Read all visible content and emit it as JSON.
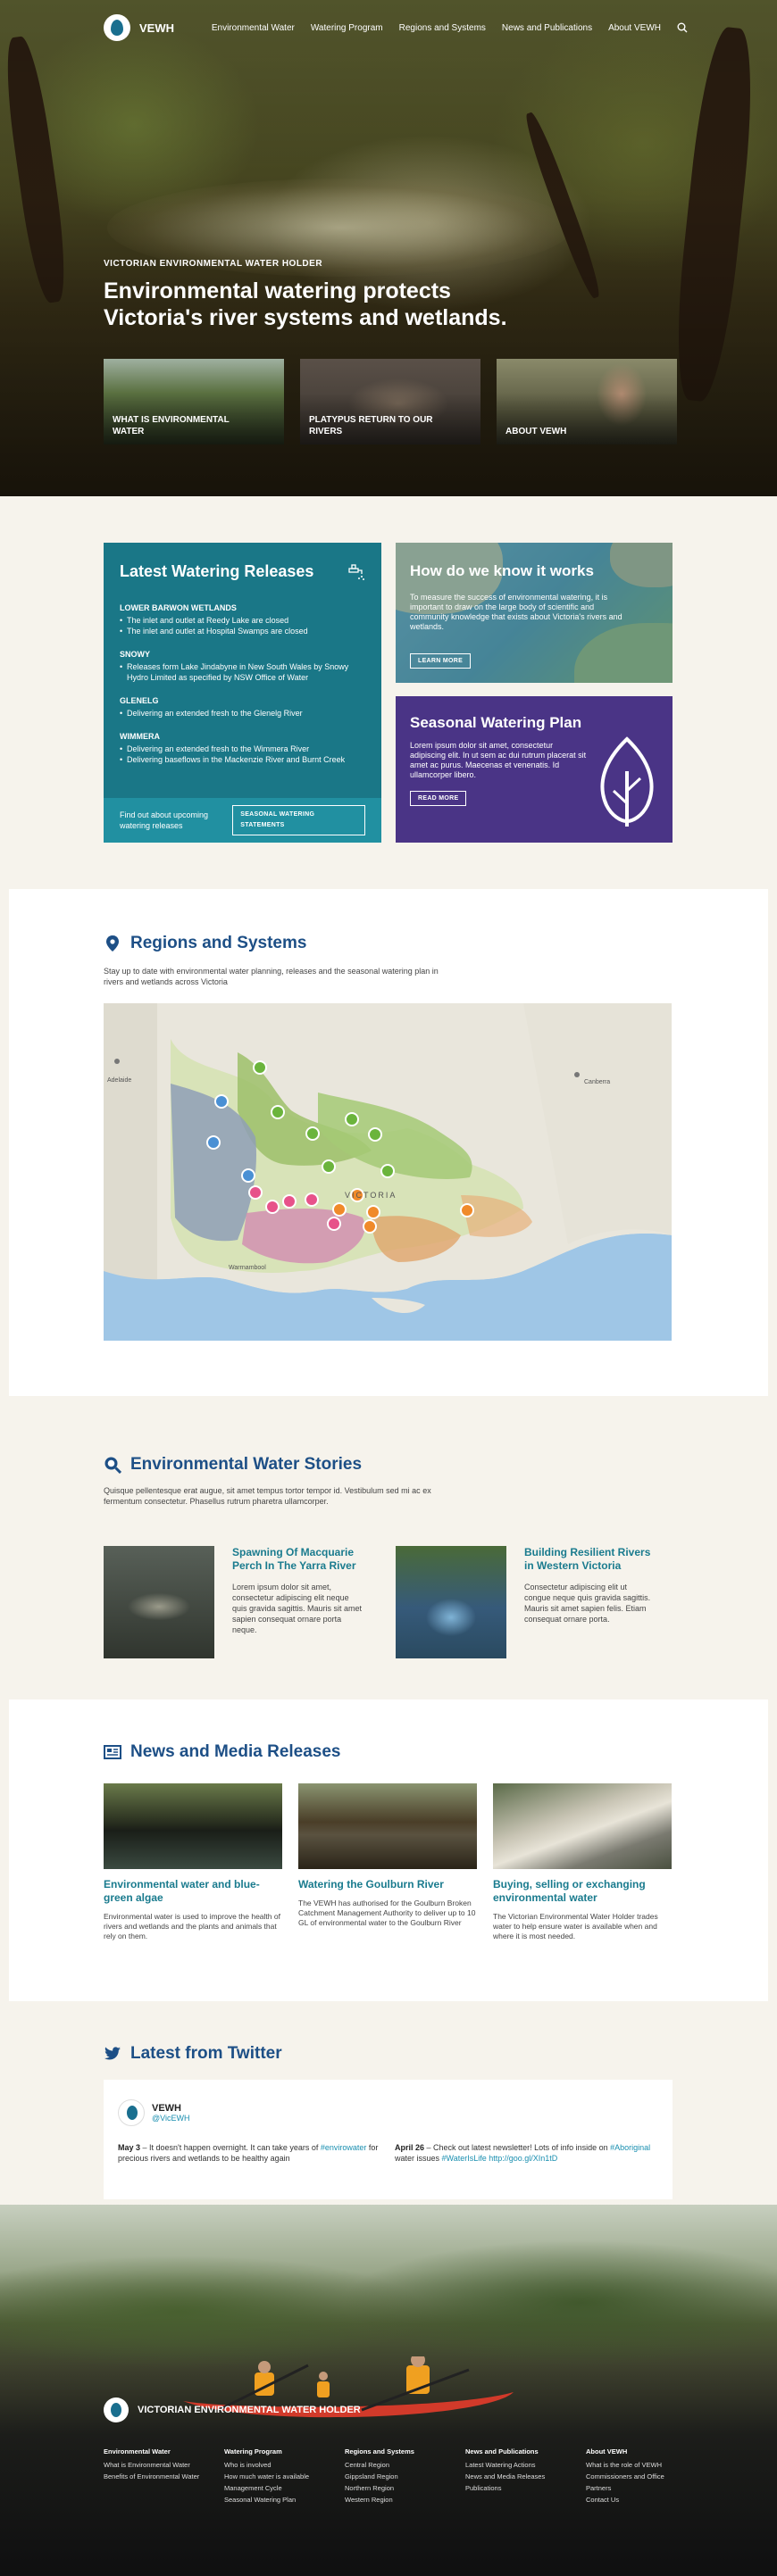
{
  "brand": {
    "name": "VEWH"
  },
  "nav": {
    "items": [
      "Environmental Water",
      "Watering Program",
      "Regions and Systems",
      "News and Publications",
      "About VEWH"
    ]
  },
  "hero": {
    "eyebrow": "VICTORIAN ENVIRONMENTAL WATER HOLDER",
    "title": "Environmental watering protects Victoria's river systems and wetlands.",
    "tiles": [
      "WHAT IS ENVIRONMENTAL WATER",
      "PLATYPUS RETURN TO OUR RIVERS",
      "ABOUT VEWH"
    ]
  },
  "latest_releases": {
    "title": "Latest Watering Releases",
    "regions": [
      {
        "name": "LOWER BARWON WETLANDS",
        "items": [
          "The inlet and outlet at Reedy Lake are closed",
          "The inlet and outlet at Hospital Swamps are closed"
        ]
      },
      {
        "name": "SNOWY",
        "items": [
          "Releases form Lake Jindabyne in New South Wales by Snowy Hydro Limited as specified by NSW Office of Water"
        ]
      },
      {
        "name": "GLENELG",
        "items": [
          "Delivering an extended fresh to the Glenelg River"
        ]
      },
      {
        "name": "WIMMERA",
        "items": [
          "Delivering an extended fresh to the Wimmera River",
          "Delivering baseflows in the Mackenzie River and Burnt Creek"
        ]
      }
    ],
    "footer_text": "Find out about upcoming watering releases",
    "footer_button": "SEASONAL WATERING STATEMENTS"
  },
  "how_we_know": {
    "title": "How do we know it works",
    "body": "To measure the success of environmental watering, it is important to draw on the large body of scientific and community knowledge that exists about Victoria's rivers and wetlands.",
    "button": "LEARN MORE"
  },
  "seasonal_plan": {
    "title": "Seasonal Watering Plan",
    "body": "Lorem ipsum dolor sit amet, consectetur adipiscing elit. In ut sem ac dui rutrum placerat sit amet ac purus. Maecenas et venenatis. Id ullamcorper libero.",
    "button": "READ MORE"
  },
  "regions": {
    "title": "Regions and Systems",
    "intro": "Stay up to date with environmental water planning, releases and the seasonal watering plan in rivers and wetlands across Victoria",
    "map_labels": {
      "adelaide": "Adelaide",
      "victoria": "VICTORIA",
      "warrnambool": "Warrnambool",
      "canberra": "Canberra"
    }
  },
  "stories": {
    "title": "Environmental Water Stories",
    "intro": "Quisque pellentesque erat augue, sit amet tempus tortor tempor id. Vestibulum sed mi ac ex fermentum consectetur. Phasellus rutrum pharetra ullamcorper.",
    "items": [
      {
        "title": "Spawning Of Macquarie Perch In The Yarra River",
        "body": "Lorem ipsum dolor sit amet, consectetur adipiscing elit neque quis gravida sagittis. Mauris sit amet sapien consequat ornare porta neque."
      },
      {
        "title": "Building Resilient Rivers in Western Victoria",
        "body": "Consectetur adipiscing elit ut congue neque quis gravida sagittis. Mauris sit amet sapien felis. Etiam consequat ornare porta."
      }
    ]
  },
  "news": {
    "title": "News and Media Releases",
    "items": [
      {
        "title": "Environmental water and blue-green algae",
        "body": "Environmental water is used to improve the health of rivers and wetlands and the plants and animals that rely on them."
      },
      {
        "title": "Watering the Goulburn River",
        "body": "The VEWH has authorised for the Goulburn Broken Catchment Management Authority to deliver up to 10 GL of environmental water to the Goulburn River"
      },
      {
        "title": "Buying, selling or exchanging environmental water",
        "body": "The Victorian Environmental Water Holder trades water to help ensure water is available when and where it is most needed."
      }
    ]
  },
  "twitter": {
    "title": "Latest from Twitter",
    "account_name": "VEWH",
    "handle": "@VicEWH",
    "tweets": [
      {
        "date": "May 3",
        "text_before": " – It doesn't happen overnight. It can take years of ",
        "tag": "#envirowater",
        "text_after": " for precious rivers and wetlands to be healthy again"
      },
      {
        "date": "April 26",
        "text_before": " – Check out latest newsletter! Lots of info inside on ",
        "tag": "#Aboriginal",
        "text_after": " water issues ",
        "link": "#WaterIsLife http://goo.gl/XIn1tD"
      }
    ]
  },
  "footer": {
    "name": "VICTORIAN ENVIRONMENTAL WATER HOLDER",
    "columns": [
      {
        "heading": "Environmental Water",
        "links": [
          "What is Environmental Water",
          "Benefits of Environmental Water"
        ]
      },
      {
        "heading": "Watering Program",
        "links": [
          "Who is involved",
          "How much water is available",
          "Management Cycle",
          "Seasonal Watering Plan"
        ]
      },
      {
        "heading": "Regions and Systems",
        "links": [
          "Central Region",
          "Gippsland Region",
          "Northern Region",
          "Western Region"
        ]
      },
      {
        "heading": "News and Publications",
        "links": [
          "Latest Watering Actions",
          "News and Media Releases",
          "Publications"
        ]
      },
      {
        "heading": "About VEWH",
        "links": [
          "What is the role of VEWH",
          "Commissioners and Office",
          "Partners",
          "Contact Us"
        ]
      }
    ]
  },
  "colors": {
    "teal": "#1a7787",
    "purple": "#4a3486",
    "navy": "#1d4f86",
    "link": "#1a7b8e"
  }
}
